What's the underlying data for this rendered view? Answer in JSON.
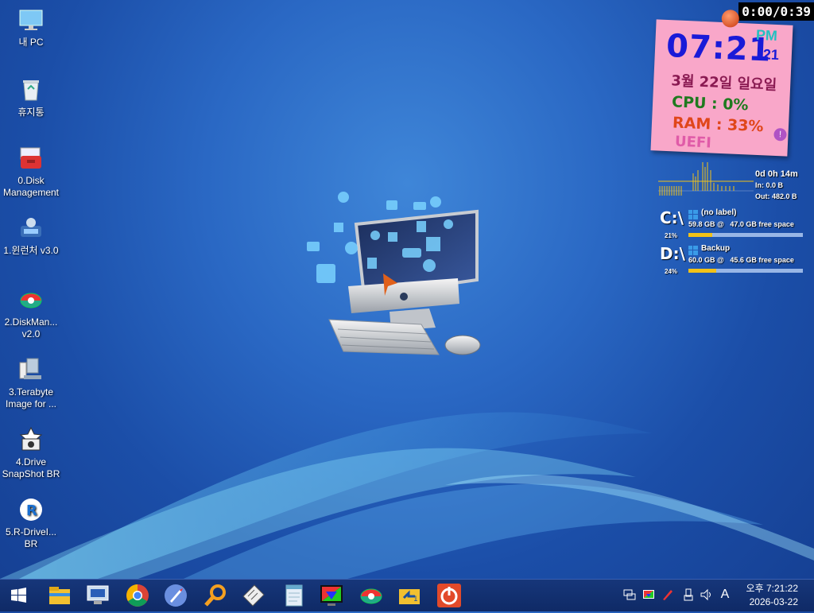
{
  "desktop": {
    "icons": [
      {
        "label": "내 PC",
        "icon": "monitor-icon"
      },
      {
        "label": "휴지통",
        "icon": "recycle-bin-icon"
      },
      {
        "label": "0.Disk\nManagement",
        "icon": "toolbox-icon"
      },
      {
        "label": "1.윈런처 v3.0",
        "icon": "launcher-icon"
      },
      {
        "label": "2.DiskMan...\nv2.0",
        "icon": "disk-manager-icon"
      },
      {
        "label": "3.Terabyte\nImage for ...",
        "icon": "terabyte-icon"
      },
      {
        "label": "4.Drive\nSnapShot BR",
        "icon": "snapshot-icon"
      },
      {
        "label": "5.R-DriveI...\nBR",
        "icon": "rdrive-icon"
      }
    ]
  },
  "countdown": "0:00/0:39",
  "note": {
    "time": "07:21",
    "ampm": "PM",
    "seconds": ":21",
    "date": "3월 22일 일요일",
    "cpu": "CPU :  0%",
    "ram": "RAM :  33%",
    "boot": "UEFI"
  },
  "network": {
    "uptime": "0d 0h 14m",
    "in": "In: 0.0 B",
    "out": "Out: 482.0 B"
  },
  "drives": [
    {
      "letter": "C:\\",
      "name": "(no label)",
      "size": "59.8 GB @",
      "free": "47.0 GB free space",
      "percent": "21%",
      "used_fraction": 0.21
    },
    {
      "letter": "D:\\",
      "name": "Backup",
      "size": "60.0 GB @",
      "free": "45.6 GB free space",
      "percent": "24%",
      "used_fraction": 0.24
    }
  ],
  "taskbar": {
    "pinned": [
      "file-explorer-icon",
      "this-pc-icon",
      "chrome-icon",
      "rocket-launcher-icon",
      "search-magnifier-icon",
      "keyboard-tool-icon",
      "notepad-icon",
      "color-monitor-icon",
      "disk-manager-icon",
      "folder-sync-icon",
      "power-button-icon"
    ],
    "tray": {
      "ime": "A",
      "time": "오후 7:21:22",
      "date": "2026-03-22"
    }
  },
  "colors": {
    "taskbar": "#0f2a66",
    "note": "#f9a7c9",
    "clock": "#1a1ad8"
  }
}
